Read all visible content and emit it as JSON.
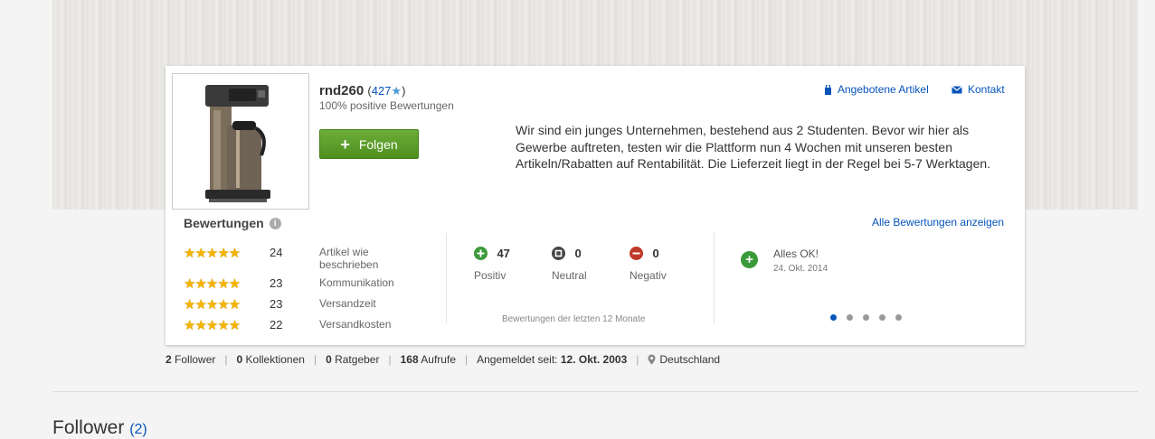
{
  "seller": {
    "name": "rnd260",
    "score_open": "(",
    "score": "427",
    "score_close": ")",
    "positive_text": "100% positive Bewertungen",
    "follow_label": "Folgen",
    "description": "Wir sind ein junges Unternehmen, bestehend aus 2 Studenten. Bevor wir hier als Gewerbe auftreten, testen wir die Plattform nun 4 Wochen mit unseren besten Artikeln/Rabatten auf Rentabilität. Die Lieferzeit liegt in der Regel bei 5-7 Werktagen."
  },
  "links": {
    "offered_items": "Angebotene Artikel",
    "contact": "Kontakt",
    "all_ratings": "Alle Bewertungen anzeigen"
  },
  "ratings": {
    "title": "Bewertungen",
    "rows": [
      {
        "stars": 5,
        "count": "24",
        "label": "Artikel wie beschrieben"
      },
      {
        "stars": 5,
        "count": "23",
        "label": "Kommunikation"
      },
      {
        "stars": 5,
        "count": "23",
        "label": "Versandzeit"
      },
      {
        "stars": 5,
        "count": "22",
        "label": "Versandkosten"
      }
    ]
  },
  "feedback": {
    "positive": {
      "count": "47",
      "label": "Positiv",
      "color": "#3a9a3a"
    },
    "neutral": {
      "count": "0",
      "label": "Neutral",
      "color": "#444444"
    },
    "negative": {
      "count": "0",
      "label": "Negativ",
      "color": "#c0392b"
    },
    "period": "Bewertungen der letzten 12 Monate"
  },
  "latest": {
    "text": "Alles OK!",
    "date": "24. Okt. 2014",
    "active_dot": 1,
    "dot_count": 5
  },
  "stats": {
    "followers_num": "2",
    "followers_label": "Follower",
    "collections_num": "0",
    "collections_label": "Kollektionen",
    "guides_num": "0",
    "guides_label": "Ratgeber",
    "views_num": "168",
    "views_label": "Aufrufe",
    "member_since_label": "Angemeldet seit:",
    "member_since_date": "12. Okt. 2003",
    "country": "Deutschland"
  },
  "follower_section": {
    "title": "Follower",
    "count": "(2)"
  },
  "colors": {
    "link": "#0654ba",
    "button_green": "#5a9e28",
    "star": "#f5b400"
  }
}
